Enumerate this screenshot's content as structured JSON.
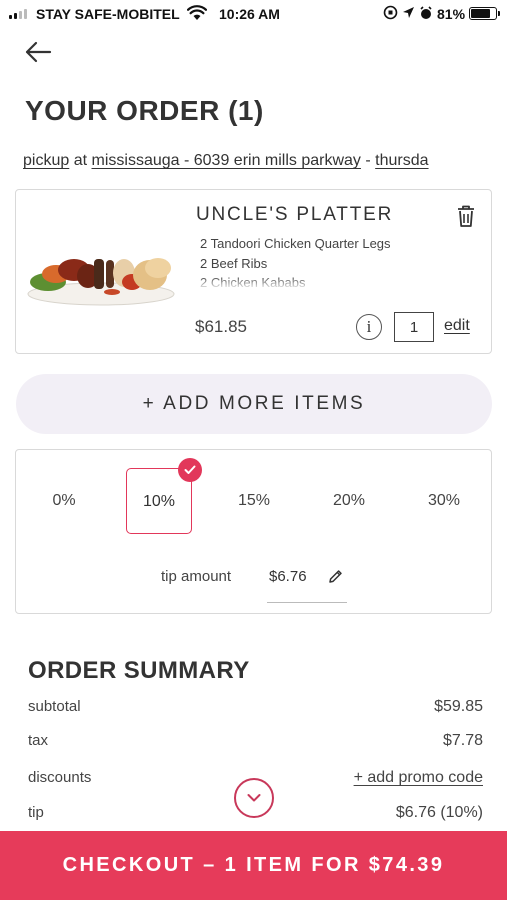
{
  "status_bar": {
    "carrier": "STAY SAFE-MOBITEL",
    "time": "10:26 AM",
    "battery": "81%",
    "battery_level": 0.81
  },
  "header": {
    "back_icon": "arrow-left-icon",
    "title": "YOUR ORDER (1)"
  },
  "pickup": {
    "mode": "pickup",
    "at": "at",
    "location": "mississauga - 6039 erin mills parkway",
    "separator": "-",
    "day": "thursda"
  },
  "cart_item": {
    "name": "UNCLE'S PLATTER",
    "description": [
      "2 Tandoori Chicken Quarter Legs",
      "2 Beef Ribs",
      "2 Chicken Kababs"
    ],
    "price": "$61.85",
    "info_label": "i",
    "quantity": "1",
    "edit_label": "edit",
    "image_icon": "food-platter-image",
    "delete_icon": "trash-icon"
  },
  "add_more": {
    "label": "+ ADD MORE ITEMS"
  },
  "tip": {
    "options": [
      "0%",
      "10%",
      "15%",
      "20%",
      "30%"
    ],
    "selected": "10%",
    "amount_label": "tip amount",
    "amount_value": "$6.76",
    "edit_icon": "pencil-icon"
  },
  "summary": {
    "title": "ORDER SUMMARY",
    "subtotal_label": "subtotal",
    "subtotal": "$59.85",
    "tax_label": "tax",
    "tax": "$7.78",
    "discounts_label": "discounts",
    "promo_link": "+ add promo code",
    "tip_label": "tip",
    "tip": "$6.76 (10%)"
  },
  "checkout": {
    "label": "CHECKOUT – 1 ITEM FOR $74.39"
  },
  "colors": {
    "accent": "#e63b5a",
    "add_button_bg": "#f2eff6",
    "card_border": "#d9d9d9"
  }
}
